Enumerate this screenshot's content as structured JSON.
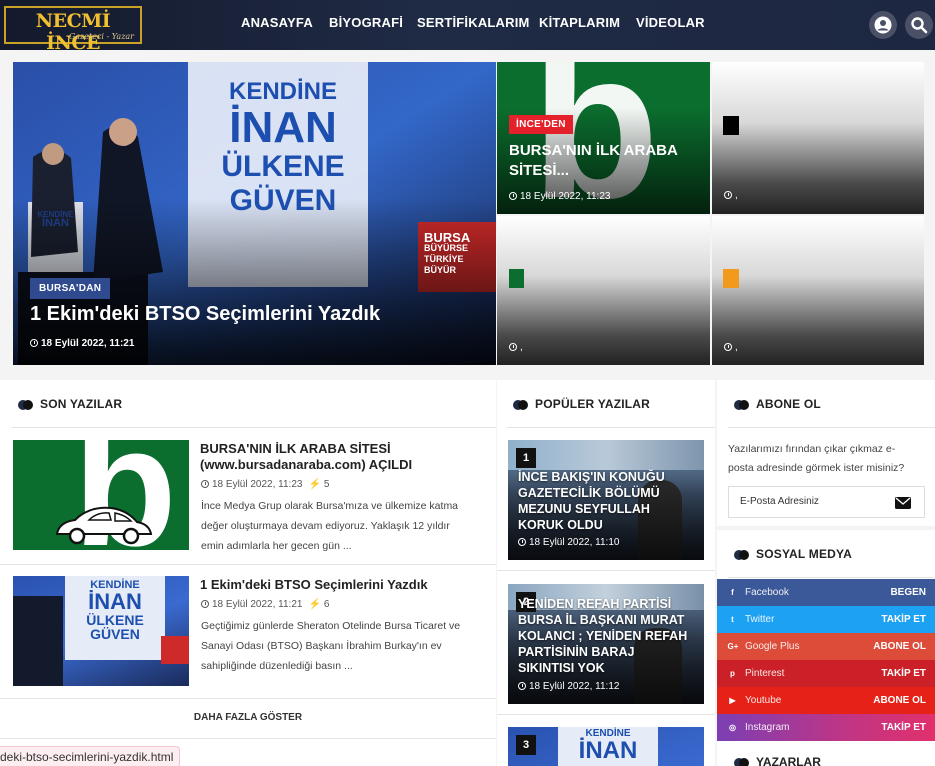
{
  "header": {
    "logo_title": "NECMİ İNCE",
    "logo_subtitle": "Gazeteci - Yazar",
    "nav": [
      "ANASAYFA",
      "BİYOGRAFİ",
      "SERTİFİKALARIM",
      "KİTAPLARIM",
      "VİDEOLAR"
    ]
  },
  "hero": {
    "main": {
      "tag": "BURSA'DAN",
      "title": "1 Ekim'deki BTSO Seçimlerini Yazdık",
      "date": "18 Eylül 2022, 11:21",
      "banner_lines": [
        "KENDİNE",
        "İNAN",
        "ÜLKENE",
        "GÜVEN"
      ],
      "side_banner": [
        "BURSA",
        "BÜYÜRSE",
        "TÜRKİYE",
        "BÜYÜR"
      ],
      "podium_sign": [
        "KENDİNE",
        "İNAN"
      ]
    },
    "tile1": {
      "tag": "İNCE'DEN",
      "title_lines": [
        "BURSA'NIN İLK ARABA",
        "SİTESİ..."
      ],
      "date": "18 Eylül 2022, 11:23",
      "logo_letter": "b"
    },
    "tile2": {
      "meta": ","
    },
    "tile3": {
      "meta": ","
    },
    "tile4": {
      "meta": ","
    }
  },
  "colors": {
    "accent_red": "#e4202a",
    "tag_blue": "#2f4a8f",
    "green": "#0b6e2e",
    "orange": "#f29a1c"
  },
  "latest": {
    "header": "SON YAZILAR",
    "posts": [
      {
        "title_lines": [
          "BURSA'NIN İLK ARABA SİTESİ",
          "(www.bursadanaraba.com) AÇILDI"
        ],
        "date": "18 Eylül 2022, 11:23",
        "views": "5",
        "excerpt_lines": [
          "İnce Medya Grup olarak Bursa'mıza ve ülkemize katma",
          "değer oluşturmaya devam ediyoruz. Yaklaşık 12 yıldır",
          "emin adımlarla her gecen gün ..."
        ]
      },
      {
        "title_lines": [
          "1 Ekim'deki BTSO Seçimlerini Yazdık"
        ],
        "date": "18 Eylül 2022, 11:21",
        "views": "6",
        "excerpt_lines": [
          "Geçtiğimiz günlerde Sheraton Otelinde Bursa Ticaret ve",
          "Sanayi Odası (BTSO) Başkanı İbrahim Burkay'ın ev",
          "sahipliğinde düzenlediği basın ..."
        ]
      }
    ],
    "more": "DAHA FAZLA GÖSTER"
  },
  "popular": {
    "header": "POPÜLER YAZILAR",
    "items": [
      {
        "num": "1",
        "title_lines": [
          "İNCE BAKIŞ'IN KONUĞU",
          "GAZETECİLİK BÖLÜMÜ",
          "MEZUNU SEYFULLAH",
          "KORUK OLDU"
        ],
        "date": "18 Eylül 2022, 11:10"
      },
      {
        "num": "2",
        "title_lines": [
          "YENİDEN REFAH PARTİSİ",
          "BURSA İL BAŞKANI MURAT",
          "KOLANCI ; YENİDEN REFAH",
          "PARTİSİNİN BARAJ",
          "SIKINTISI YOK"
        ],
        "date": "18 Eylül 2022, 11:12"
      },
      {
        "num": "3",
        "banner_lines": [
          "KENDİNE",
          "İNAN"
        ]
      }
    ]
  },
  "subscribe": {
    "header": "ABONE OL",
    "text_lines": [
      "Yazılarımızı fırından çıkar çıkmaz e-",
      "posta adresinde görmek ister misiniz?"
    ],
    "placeholder": "E-Posta Adresiniz"
  },
  "social": {
    "header": "SOSYAL MEDYA",
    "items": [
      {
        "name": "Facebook",
        "action": "BEGEN",
        "color": "#3b5998",
        "icon": "f"
      },
      {
        "name": "Twitter",
        "action": "TAKİP ET",
        "color": "#1da1f2",
        "icon": "t"
      },
      {
        "name": "Google Plus",
        "action": "ABONE OL",
        "color": "#dd4b39",
        "icon": "G+"
      },
      {
        "name": "Pinterest",
        "action": "TAKİP ET",
        "color": "#cb2027",
        "icon": "p"
      },
      {
        "name": "Youtube",
        "action": "ABONE OL",
        "color": "#e62117",
        "icon": "▶"
      },
      {
        "name": "Instagram",
        "action": "TAKİP ET",
        "color": "#c13584",
        "icon": "◎"
      }
    ]
  },
  "authors": {
    "header": "YAZARLAR"
  },
  "statusbar": {
    "url": "deki-btso-secimlerini-yazdik.html"
  }
}
